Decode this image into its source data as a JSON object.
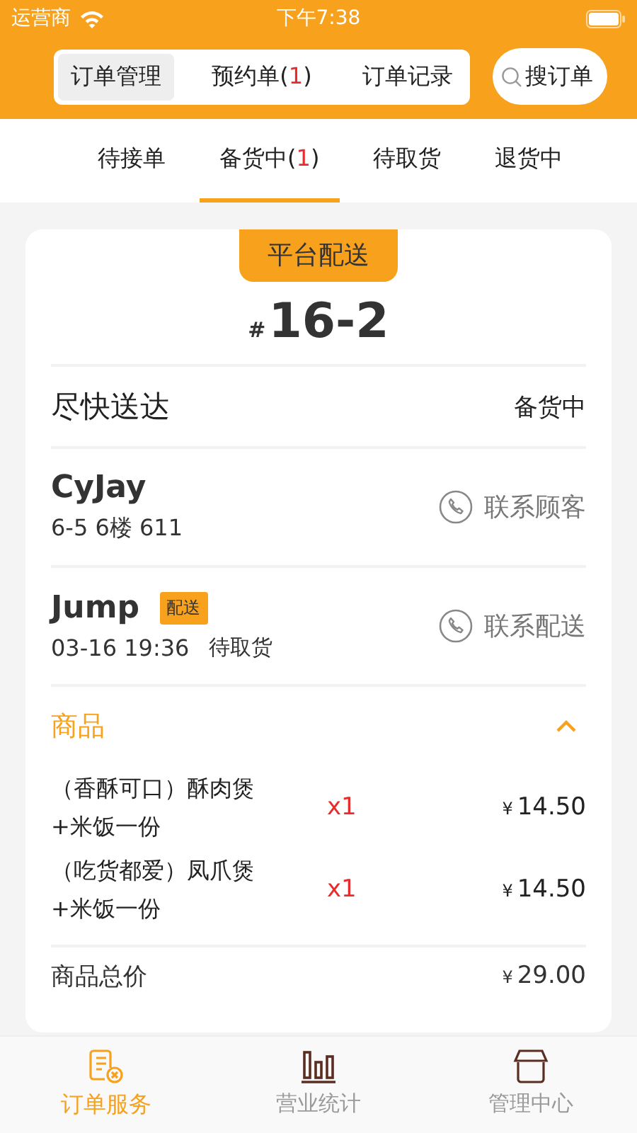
{
  "status_bar": {
    "carrier": "运营商",
    "time": "下午7:38"
  },
  "segments": [
    {
      "before": "订单管理",
      "selected": true
    },
    {
      "before": "预约单(",
      "count": "1",
      "after": ")",
      "selected": false
    },
    {
      "before": "订单记录",
      "selected": false
    }
  ],
  "search": {
    "label": "搜订单"
  },
  "tabs": [
    {
      "before": "待接单",
      "selected": false
    },
    {
      "before": "备货中(",
      "count": "1",
      "after": ")",
      "selected": true
    },
    {
      "before": "待取货",
      "selected": false
    },
    {
      "before": "退货中",
      "selected": false
    }
  ],
  "order": {
    "delivery_badge": "平台配送",
    "hash": "#",
    "number": "16-2",
    "timing": "尽快送达",
    "status": "备货中",
    "customer": {
      "name": "CyJay",
      "address": "6-5 6楼 611",
      "action": "联系顾客"
    },
    "courier": {
      "name": "Jump",
      "tag": "配送",
      "time": "03-16 19:36",
      "state": "待取货",
      "action": "联系配送"
    },
    "goods": {
      "title": "商品",
      "expanded": true,
      "items": [
        {
          "name": "（香酥可口）酥肉煲+米饭一份",
          "qty": "x1",
          "currency": "¥",
          "price": "14.50"
        },
        {
          "name": "（吃货都爱）凤爪煲+米饭一份",
          "qty": "x1",
          "currency": "¥",
          "price": "14.50"
        }
      ],
      "total_label": "商品总价",
      "total_currency": "¥",
      "total": "29.00"
    }
  },
  "bottom_nav": [
    {
      "label": "订单服务",
      "selected": true
    },
    {
      "label": "营业统计",
      "selected": false
    },
    {
      "label": "管理中心",
      "selected": false
    }
  ]
}
